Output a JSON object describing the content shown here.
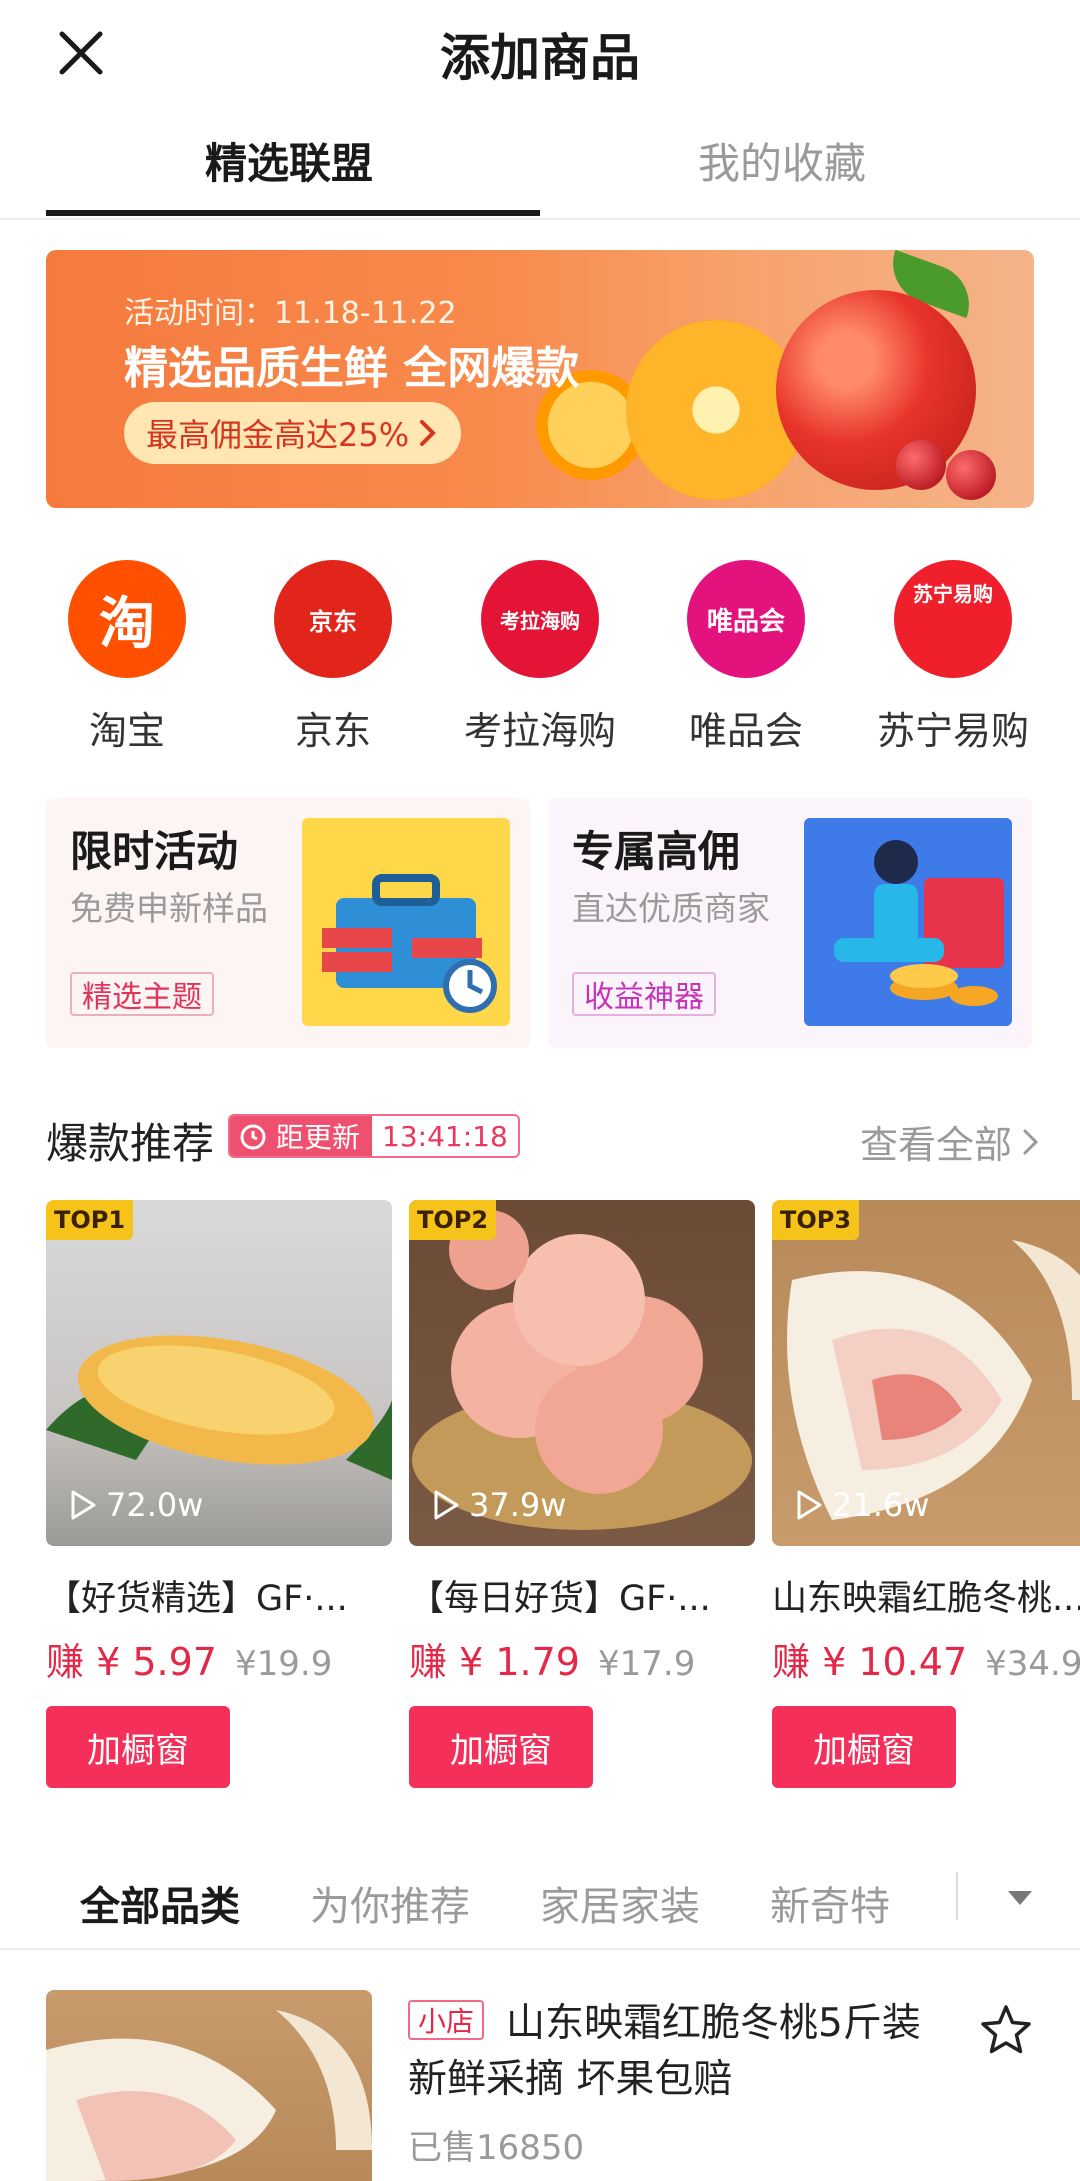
{
  "header": {
    "title": "添加商品",
    "close_icon": "close-icon"
  },
  "tabs": [
    {
      "label": "精选联盟",
      "active": true
    },
    {
      "label": "我的收藏",
      "active": false
    }
  ],
  "banner": {
    "date": "活动时间：11.18-11.22",
    "headline": "精选品质生鲜 全网爆款",
    "cta": "最高佣金高达25%",
    "cta_icon": "chevron-right-icon"
  },
  "platforms": [
    {
      "name": "淘宝",
      "logo_text": "淘",
      "color": "#ff5000"
    },
    {
      "name": "京东",
      "logo_text": "京东",
      "color": "#e1251b"
    },
    {
      "name": "考拉海购",
      "logo_text": "考拉海购",
      "color": "#e31436"
    },
    {
      "name": "唯品会",
      "logo_text": "唯品会",
      "color": "#e4127c"
    },
    {
      "name": "苏宁易购",
      "logo_text": "苏宁易购",
      "color": "#ef1f2b"
    }
  ],
  "promos": [
    {
      "title": "限时活动",
      "subtitle": "免费申新样品",
      "tag": "精选主题"
    },
    {
      "title": "专属高佣",
      "subtitle": "直达优质商家",
      "tag": "收益神器"
    }
  ],
  "hot": {
    "title": "爆款推荐",
    "countdown_label": "距更新",
    "countdown_time": "13:41:18",
    "view_all": "查看全部"
  },
  "products": [
    {
      "rank": "TOP1",
      "views": "72.0w",
      "name": "【好货精选】GF·...",
      "earn_label": "赚",
      "earn": "¥ 5.97",
      "price": "¥19.9",
      "button": "加橱窗"
    },
    {
      "rank": "TOP2",
      "views": "37.9w",
      "name": "【每日好货】GF·...",
      "earn_label": "赚",
      "earn": "¥ 1.79",
      "price": "¥17.9",
      "button": "加橱窗"
    },
    {
      "rank": "TOP3",
      "views": "21.6w",
      "name": "山东映霜红脆冬桃...",
      "earn_label": "赚",
      "earn": "¥ 10.47",
      "price": "¥34.9",
      "button": "加橱窗"
    }
  ],
  "categories": [
    {
      "label": "全部品类",
      "active": true
    },
    {
      "label": "为你推荐",
      "active": false
    },
    {
      "label": "家居家装",
      "active": false
    },
    {
      "label": "新奇特",
      "active": false
    }
  ],
  "list_item": {
    "badge": "小店",
    "title": "山东映霜红脆冬桃5斤装 新鲜采摘 坏果包赔",
    "sold": "已售16850"
  },
  "colors": {
    "accent": "#f42f5a",
    "earn": "#e42848",
    "muted": "#9a9a9a"
  }
}
